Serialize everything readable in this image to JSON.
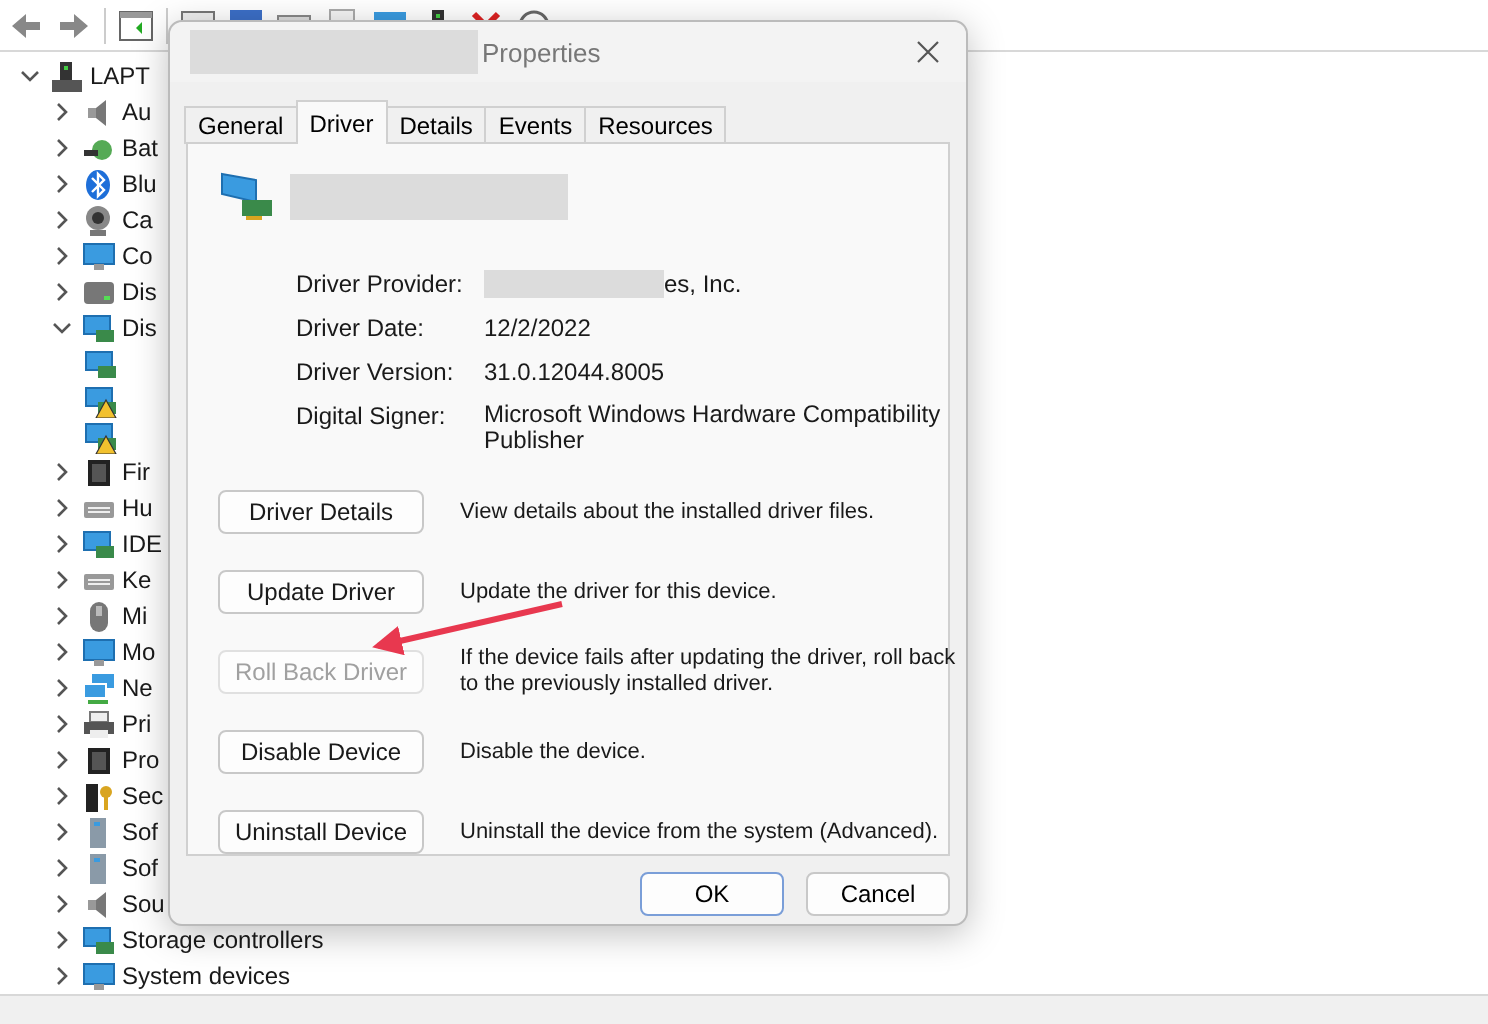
{
  "tree": {
    "label": "LAPT",
    "expanded": true,
    "children": [
      {
        "label": "Au",
        "kind": "speaker",
        "expanded": false
      },
      {
        "label": "Bat",
        "kind": "battery",
        "expanded": false
      },
      {
        "label": "Blu",
        "kind": "bluetooth",
        "expanded": false
      },
      {
        "label": "Ca",
        "kind": "camera",
        "expanded": false
      },
      {
        "label": "Co",
        "kind": "monitor",
        "expanded": false
      },
      {
        "label": "Dis",
        "kind": "disk",
        "expanded": false
      },
      {
        "label": "Dis",
        "kind": "adapter",
        "expanded": true,
        "children": [
          {
            "kind": "adapter",
            "warning": false
          },
          {
            "kind": "adapter",
            "warning": true
          },
          {
            "kind": "adapter",
            "warning": true
          }
        ]
      },
      {
        "label": "Fir",
        "kind": "chip",
        "expanded": false
      },
      {
        "label": "Hu",
        "kind": "keyboard",
        "expanded": false
      },
      {
        "label": "IDE",
        "kind": "adapter",
        "expanded": false
      },
      {
        "label": "Ke",
        "kind": "keyboard",
        "expanded": false
      },
      {
        "label": "Mi",
        "kind": "mouse",
        "expanded": false
      },
      {
        "label": "Mo",
        "kind": "monitor",
        "expanded": false
      },
      {
        "label": "Ne",
        "kind": "network",
        "expanded": false
      },
      {
        "label": "Pri",
        "kind": "printer",
        "expanded": false
      },
      {
        "label": "Pro",
        "kind": "chip",
        "expanded": false
      },
      {
        "label": "Sec",
        "kind": "key",
        "expanded": false
      },
      {
        "label": "Sof",
        "kind": "server",
        "expanded": false
      },
      {
        "label": "Sof",
        "kind": "server",
        "expanded": false
      },
      {
        "label": "Sou",
        "kind": "speaker",
        "expanded": false
      },
      {
        "label": "Storage controllers",
        "kind": "adapter",
        "expanded": false
      },
      {
        "label": "System devices",
        "kind": "monitor",
        "expanded": false
      }
    ]
  },
  "dialog": {
    "title": "Properties",
    "title_redacted": true,
    "name_redacted": true,
    "tabs": [
      {
        "label": "General",
        "selected": false
      },
      {
        "label": "Driver",
        "selected": true
      },
      {
        "label": "Details",
        "selected": false
      },
      {
        "label": "Events",
        "selected": false
      },
      {
        "label": "Resources",
        "selected": false
      }
    ],
    "fields": [
      {
        "label": "Driver Provider:",
        "value": "es, Inc.",
        "redacted": true
      },
      {
        "label": "Driver Date:",
        "value": "12/2/2022",
        "redacted": false
      },
      {
        "label": "Driver Version:",
        "value": "31.0.12044.8005",
        "redacted": false
      },
      {
        "label": "Digital Signer:",
        "value": "Microsoft Windows Hardware Compatibility Publisher",
        "redacted": false
      }
    ],
    "actions": [
      {
        "label": "Driver Details",
        "description": "View details about the installed driver files.",
        "disabled": false
      },
      {
        "label": "Update Driver",
        "description": "Update the driver for this device.",
        "disabled": false
      },
      {
        "label": "Roll Back Driver",
        "description": "If the device fails after updating the driver, roll back to the previously installed driver.",
        "disabled": true
      },
      {
        "label": "Disable Device",
        "description": "Disable the device.",
        "disabled": false
      },
      {
        "label": "Uninstall Device",
        "description": "Uninstall the device from the system (Advanced).",
        "disabled": false
      }
    ],
    "buttons": [
      {
        "label": "OK",
        "default": true
      },
      {
        "label": "Cancel",
        "default": false
      }
    ]
  }
}
